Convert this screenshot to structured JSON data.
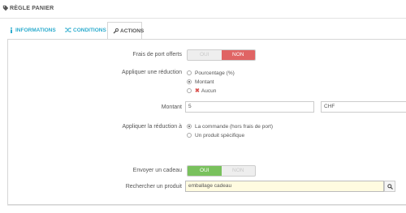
{
  "header": {
    "title": "RÈGLE PANIER"
  },
  "tabs": [
    {
      "label": "INFORMATIONS"
    },
    {
      "label": "CONDITIONS"
    },
    {
      "label": "ACTIONS"
    }
  ],
  "free_shipping": {
    "label": "Frais de port offerts",
    "yes": "OUI",
    "no": "NON",
    "selected": "NON"
  },
  "apply_discount": {
    "label": "Appliquer une réduction",
    "options": [
      "Pourcentage (%)",
      "Montant",
      "Aucun"
    ],
    "selected": "Montant"
  },
  "amount": {
    "label": "Montant",
    "value": "5",
    "currency": "CHF"
  },
  "apply_to": {
    "label": "Appliquer la réduction à",
    "options": [
      "La commande (hors frais de port)",
      "Un produit spécifique"
    ],
    "selected": "La commande (hors frais de port)"
  },
  "send_gift": {
    "label": "Envoyer un cadeau",
    "yes": "OUI",
    "no": "NON",
    "selected": "OUI"
  },
  "search_product": {
    "label": "Rechercher un produit",
    "value": "emballage cadeau"
  },
  "colors": {
    "accent": "#2eacce",
    "no_active": "#e06464",
    "yes_active": "#79c15d"
  }
}
